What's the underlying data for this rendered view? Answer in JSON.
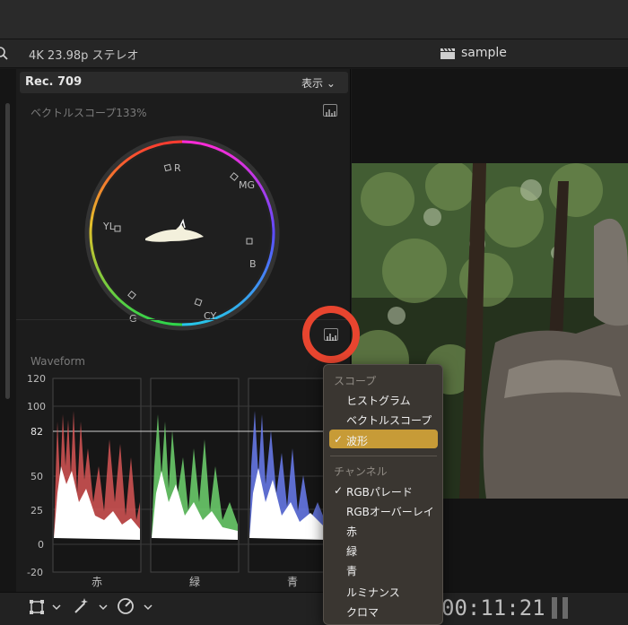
{
  "header": {
    "format": "4K 23.98p ステレオ",
    "project": "sample"
  },
  "scopes": {
    "preset": "Rec. 709",
    "view_menu": "表示 ⌄",
    "vectorscope": {
      "title": "ベクトルスコープ",
      "zoom": "133%",
      "targets": [
        "R",
        "MG",
        "B",
        "CY",
        "G",
        "YL"
      ]
    },
    "waveform": {
      "title": "Waveform",
      "scale": [
        "120",
        "100",
        "82",
        "50",
        "25",
        "0",
        "-20"
      ],
      "channels": [
        "赤",
        "緑",
        "青"
      ]
    }
  },
  "menu": {
    "section_scope": "スコープ",
    "items": [
      "ヒストグラム",
      "ベクトルスコープ",
      "波形"
    ],
    "selected": "波形",
    "section_channel": "チャンネル",
    "channels": [
      "RGBパレード",
      "RGBオーバーレイ",
      "赤",
      "緑",
      "青",
      "ルミナンス",
      "クロマ"
    ],
    "checked_channel": "RGBパレード",
    "check_mark": "✓"
  },
  "viewer": {
    "timecode": "00:11:21"
  },
  "colors": {
    "accent": "#c79b37",
    "highlight_ring": "#e8452f",
    "red": "#e05a5a",
    "green": "#6fd36f",
    "blue": "#6a7cf0"
  }
}
